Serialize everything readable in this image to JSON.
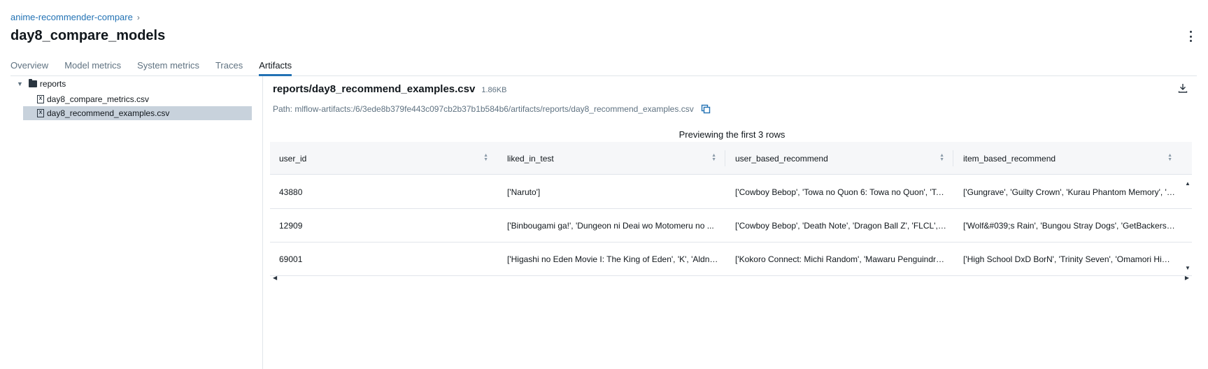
{
  "breadcrumb": {
    "experiment": "anime-recommender-compare",
    "separator": "›"
  },
  "run": {
    "title": "day8_compare_models"
  },
  "tabs": [
    {
      "label": "Overview"
    },
    {
      "label": "Model metrics"
    },
    {
      "label": "System metrics"
    },
    {
      "label": "Traces"
    },
    {
      "label": "Artifacts",
      "active": true
    }
  ],
  "tree": {
    "folder": "reports",
    "files": [
      {
        "name": "day8_compare_metrics.csv",
        "selected": false
      },
      {
        "name": "day8_recommend_examples.csv",
        "selected": true
      }
    ]
  },
  "artifact": {
    "title": "reports/day8_recommend_examples.csv",
    "size": "1.86KB",
    "path": "Path: mlflow-artifacts:/6/3ede8b379fe443c097cb2b37b1b584b6/artifacts/reports/day8_recommend_examples.csv",
    "preview_note": "Previewing the first 3 rows"
  },
  "table": {
    "columns": [
      "user_id",
      "liked_in_test",
      "user_based_recommend",
      "item_based_recommend"
    ],
    "rows": [
      [
        "43880",
        "['Naruto']",
        "['Cowboy Bebop', 'Towa no Quon 6: Towa no Quon', 'To...",
        "['Gungrave', 'Guilty Crown', 'Kurau Phantom Memory', 'T..."
      ],
      [
        "12909",
        "['Binbougami ga!', 'Dungeon ni Deai wo Motomeru no ...",
        "['Cowboy Bebop', 'Death Note', 'Dragon Ball Z', 'FLCL', '...",
        "['Wolf&#039;s Rain', 'Bungou Stray Dogs', 'GetBackers', '..."
      ],
      [
        "69001",
        "['Higashi no Eden Movie I: The King of Eden', 'K', 'Aldno...",
        "['Kokoro Connect: Michi Random', 'Mawaru Penguindru...",
        "['High School DxD BorN', 'Trinity Seven', 'Omamori Him..."
      ]
    ]
  },
  "colors": {
    "accent": "#2272b4",
    "selected_row": "#c8d2dc",
    "header_bg": "#f6f7f9"
  }
}
